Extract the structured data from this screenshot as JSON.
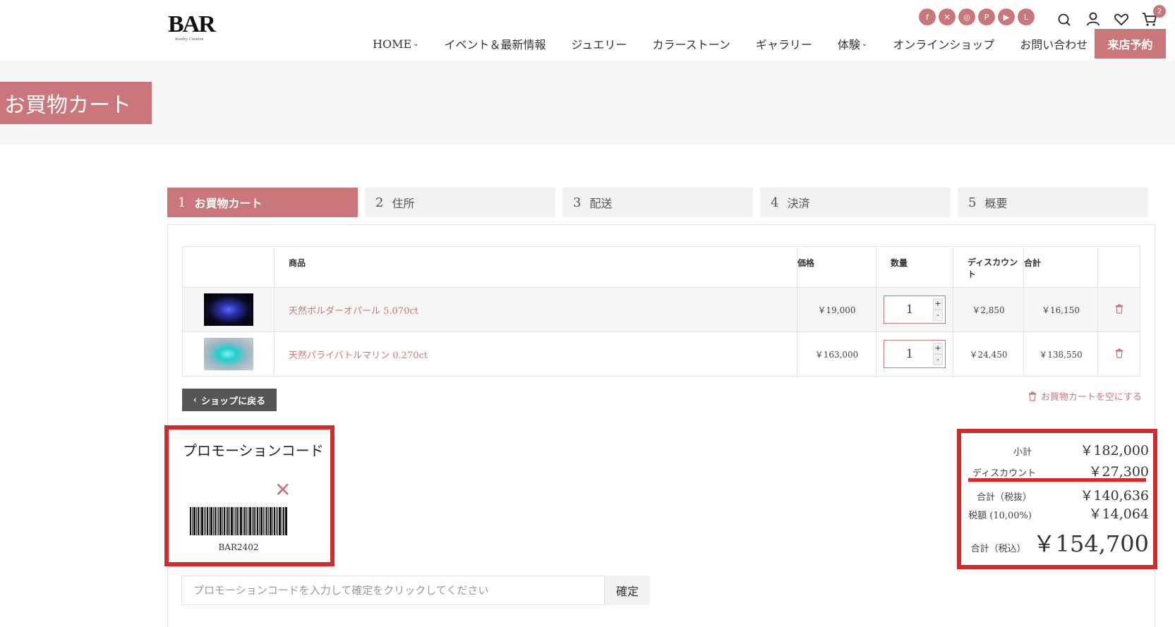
{
  "logo": {
    "main": "BAR",
    "sub": "Jewelry Creation"
  },
  "social": [
    {
      "icon": "facebook-icon",
      "glyph": "f"
    },
    {
      "icon": "x-icon",
      "glyph": "✕"
    },
    {
      "icon": "instagram-icon",
      "glyph": "◎"
    },
    {
      "icon": "pinterest-icon",
      "glyph": "P"
    },
    {
      "icon": "youtube-icon",
      "glyph": "▶"
    },
    {
      "icon": "line-icon",
      "glyph": "L"
    }
  ],
  "cart_count": "2",
  "nav": {
    "items": [
      "HOME",
      "イベント＆最新情報",
      "ジュエリー",
      "カラーストーン",
      "ギャラリー",
      "体験",
      "オンラインショップ",
      "お問い合わせ"
    ],
    "cta": "来店予約"
  },
  "page_title": "お買物カート",
  "steps": [
    {
      "num": "1",
      "label": "お買物カート"
    },
    {
      "num": "2",
      "label": "住所"
    },
    {
      "num": "3",
      "label": "配送"
    },
    {
      "num": "4",
      "label": "決済"
    },
    {
      "num": "5",
      "label": "概要"
    }
  ],
  "table": {
    "headers": {
      "product": "商品",
      "price": "価格",
      "qty": "数量",
      "discount": "ディスカウント",
      "total": "合計"
    },
    "rows": [
      {
        "name": "天然ボルダーオパール 5.070ct",
        "price": "￥19,000",
        "qty": "1",
        "discount": "￥2,850",
        "total": "￥16,150"
      },
      {
        "name": "天然パライバトルマリン 0.270ct",
        "price": "￥163,000",
        "qty": "1",
        "discount": "￥24,450",
        "total": "￥138,550"
      }
    ]
  },
  "back_button": "ショップに戻る",
  "empty_cart": "お買物カートを空にする",
  "promo": {
    "title": "プロモーションコード",
    "code": "BAR2402",
    "placeholder": "プロモーションコードを入力して確定をクリックしてください",
    "submit": "確定"
  },
  "summary": {
    "subtotal_label": "小計",
    "subtotal": "￥182,000",
    "discount_label": "ディスカウント",
    "discount": "￥27,300",
    "net_label": "合計（税抜）",
    "net": "￥140,636",
    "tax_label": "税額 (10,00%)",
    "tax": "￥14,064",
    "grand_label": "合計（税込）",
    "grand": "￥154,700"
  },
  "colors": {
    "accent": "#c9777a",
    "highlight": "#cf2d2d"
  }
}
